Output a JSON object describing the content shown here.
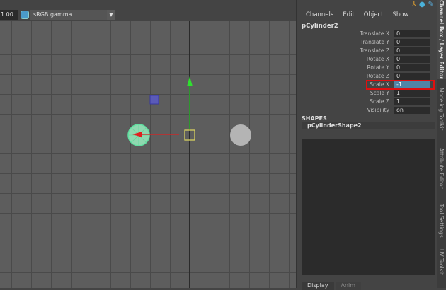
{
  "viewport": {
    "gamma_value": "1.00",
    "color_space": "sRGB gamma"
  },
  "channel_box": {
    "menu": [
      "Channels",
      "Edit",
      "Object",
      "Show"
    ],
    "object_name": "pCylinder2",
    "attributes": [
      {
        "label": "Translate X",
        "value": "0"
      },
      {
        "label": "Translate Y",
        "value": "0"
      },
      {
        "label": "Translate Z",
        "value": "0"
      },
      {
        "label": "Rotate X",
        "value": "0"
      },
      {
        "label": "Rotate Y",
        "value": "0"
      },
      {
        "label": "Rotate Z",
        "value": "0"
      },
      {
        "label": "Scale X",
        "value": "-1"
      },
      {
        "label": "Scale Y",
        "value": "1"
      },
      {
        "label": "Scale Z",
        "value": "1"
      },
      {
        "label": "Visibility",
        "value": "on"
      }
    ],
    "shapes_header": "SHAPES",
    "shape_name": "pCylinderShape2",
    "tabs": [
      "Display",
      "Anim"
    ]
  },
  "side_tabs": [
    "Channel Box / Layer Editor",
    "Modeling Toolkit",
    "Attribute Editor",
    "Tool Settings",
    "UV Toolkit"
  ],
  "colors": {
    "highlight": "#e01010",
    "selected": "#5285a6"
  }
}
